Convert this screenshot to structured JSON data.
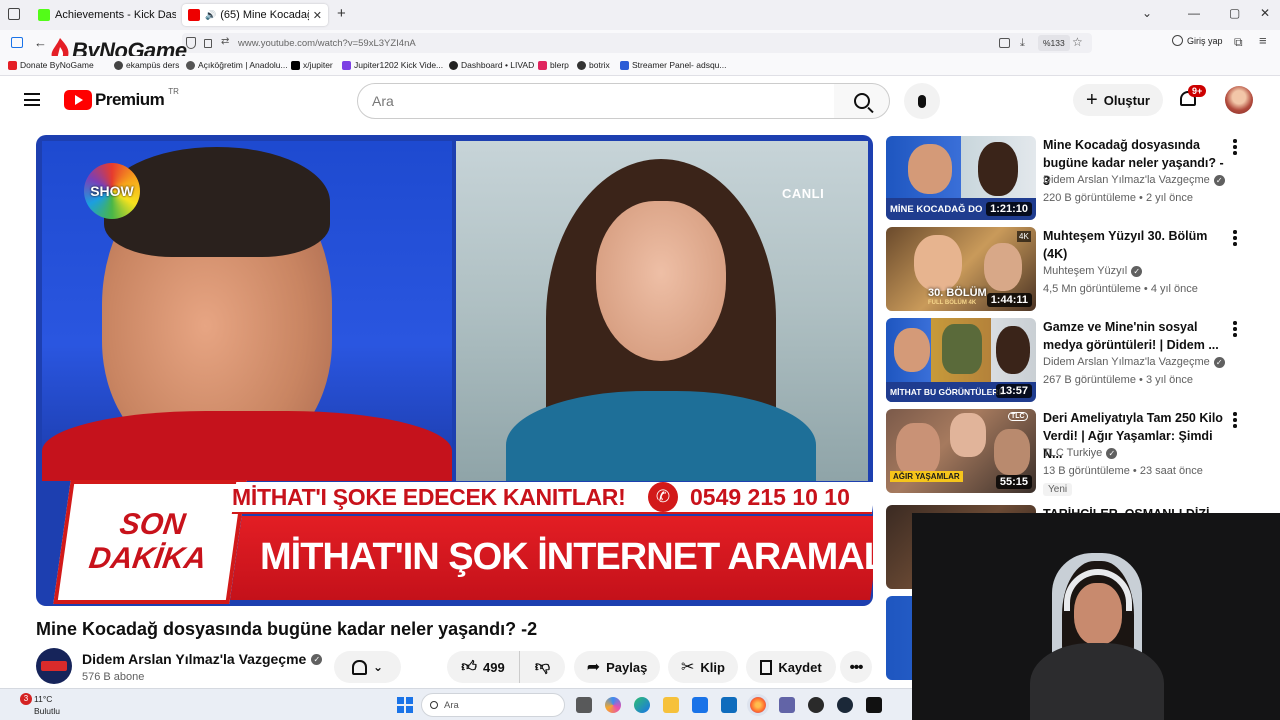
{
  "browser": {
    "tabs": [
      {
        "label": "Achievements - Kick Dashboard",
        "active": false
      },
      {
        "label": "(65) Mine Kocadağ dosyasın",
        "active": true
      }
    ],
    "url": "www.youtube.com/watch?v=59xL3YZI4nA",
    "zoom": "%133",
    "signin_label": "Giriş yap",
    "bookmarks": [
      "Donate ByNoGame",
      "ekampüs ders",
      "Açıköğretim | Anadolu...",
      "x/jupiter",
      "Jupiter1202 Kick Vide...",
      "Dashboard • LIVAD",
      "blerp",
      "botrix",
      "Streamer Panel- adsqu..."
    ]
  },
  "overlay_logo": "ByNoGame",
  "youtube": {
    "logo_text": "Premium",
    "logo_region": "TR",
    "search_placeholder": "Ara",
    "create_label": "Oluştur",
    "notif_count": "9+"
  },
  "player": {
    "channel_logo": "SHOW",
    "live_label": "CANLI",
    "banner_left": [
      "SON",
      "DAKİKA"
    ],
    "banner_top": "MİTHAT'I ŞOKE EDECEK KANITLAR!",
    "banner_phone": "0549 215 10 10",
    "banner_main": "MİTHAT'IN ŞOK İNTERNET ARAMALARI!"
  },
  "video": {
    "title": "Mine Kocadağ dosyasında bugüne kadar neler yaşandı? -2",
    "channel": "Didem Arslan Yılmaz'la Vazgeçme",
    "subscribers": "576 B abone",
    "likes": "499",
    "share_label": "Paylaş",
    "clip_label": "Klip",
    "save_label": "Kaydet"
  },
  "recommendations": [
    {
      "title": "Mine Kocadağ dosyasında bugüne kadar neler yaşandı? - 3",
      "channel": "Didem Arslan Yılmaz'la Vazgeçme",
      "views": "220 B görüntüleme",
      "age": "2 yıl önce",
      "duration": "1:21:10",
      "thumb_text": "MİNE KOCADAĞ DO",
      "badge": ""
    },
    {
      "title": "Muhteşem Yüzyıl 30. Bölüm (4K)",
      "channel": "Muhteşem Yüzyıl",
      "views": "4,5 Mn görüntüleme",
      "age": "4 yıl önce",
      "duration": "1:44:11",
      "thumb_text": "30. BÖLÜM",
      "thumb_sub": "FULL BÖLÜM 4K",
      "badge": ""
    },
    {
      "title": "Gamze ve Mine'nin sosyal medya görüntüleri! | Didem ...",
      "channel": "Didem Arslan Yılmaz'la Vazgeçme",
      "views": "267 B görüntüleme",
      "age": "3 yıl önce",
      "duration": "13:57",
      "thumb_text": "MİTHAT BU GÖRÜNTÜLERE",
      "badge": ""
    },
    {
      "title": "Deri Ameliyatıyla Tam 250 Kilo Verdi! | Ağır Yaşamlar: Şimdi N...",
      "channel": "TLC Turkiye",
      "views": "13 B görüntüleme",
      "age": "23 saat önce",
      "duration": "55:15",
      "thumb_text": "AĞIR YAŞAMLAR",
      "badge": "Yeni"
    },
    {
      "title": "TARİHÇİLER, OSMANLI DİZİ",
      "channel": "",
      "views": "",
      "age": "",
      "duration": "",
      "thumb_text": "",
      "badge": ""
    }
  ],
  "sep": "•",
  "taskbar": {
    "weather_temp": "11°C",
    "weather_desc": "Bulutlu",
    "weather_badge": "3",
    "search_label": "Ara"
  }
}
